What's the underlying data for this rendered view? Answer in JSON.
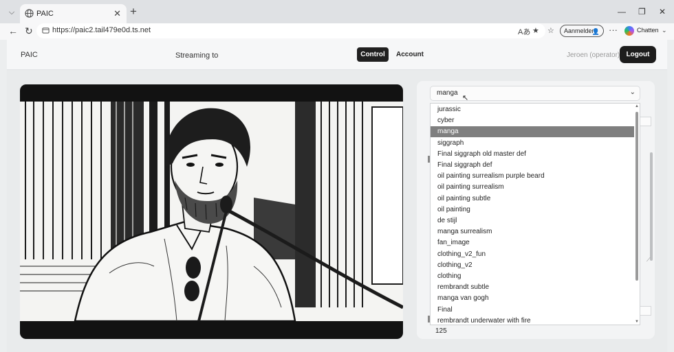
{
  "browser": {
    "tab_title": "PAIC",
    "url": "https://paic2.tail479e0d.ts.net",
    "login_label": "Aanmelden",
    "chat_label": "Chatten"
  },
  "header": {
    "brand": "PAIC",
    "streaming_label": "Streaming to",
    "nav": {
      "control": "Control",
      "account": "Account"
    },
    "user": "Jeroen (operator)",
    "logout": "Logout"
  },
  "style_select": {
    "value": "manga",
    "options": [
      "jurassic",
      "cyber",
      "manga",
      "siggraph",
      "Final siggraph old master def",
      "Final siggraph def",
      "oil painting surrealism purple beard",
      "oil painting surrealism",
      "oil painting subtle",
      "oil painting",
      "de stijl",
      "manga surrealism",
      "fan_image",
      "clothing_v2_fun",
      "clothing_v2",
      "clothing",
      "rembrandt subtle",
      "manga van gogh",
      "Final",
      "rembrandt underwater with fire"
    ],
    "selected_index": 2
  },
  "panel": {
    "number_value": "125"
  }
}
